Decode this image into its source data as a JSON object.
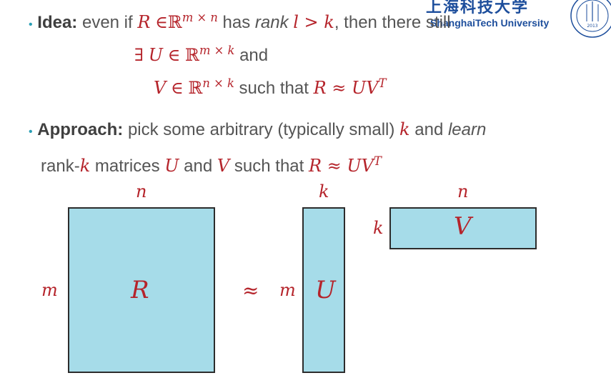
{
  "logo": {
    "cn": "上海科技大学",
    "en": "ShanghaiTech University",
    "seal_year": "2013",
    "seal_text": "SHANGHAITECH UNIV"
  },
  "idea": {
    "bullet": "•",
    "label": "Idea:",
    "text1": "even if",
    "R": "R",
    "in1": "∈",
    "reals1": "ℝ",
    "dims1": "m × n",
    "text2": "has",
    "rank": "rank",
    "rank_expr": "l > k",
    "text3": ", then there still",
    "line2_exists": "∃",
    "line2_U": "U",
    "line2_in": "∈",
    "line2_reals": "ℝ",
    "line2_dims": "m × k",
    "line2_and": "and",
    "line3_V": "V",
    "line3_in": "∈",
    "line3_reals": "ℝ",
    "line3_dims": "n × k",
    "line3_such": "such that",
    "line3_expr": "R ≈ UV",
    "line3_T": "T"
  },
  "approach": {
    "bullet": "•",
    "label": "Approach:",
    "text1": "pick some arbitrary (typically small)",
    "k": "k",
    "and": "and",
    "learn": "learn",
    "line2_rank": "rank-",
    "line2_k": "k",
    "line2_text": "matrices",
    "line2_U": "U",
    "line2_and": "and",
    "line2_V": "V",
    "line2_such": "such that",
    "line2_expr": "R ≈ UV",
    "line2_T": "T"
  },
  "diagram": {
    "R_label": "R",
    "R_cols": "n",
    "R_rows": "m",
    "approx": "≈",
    "U_label": "U",
    "U_cols": "k",
    "U_rows": "m",
    "V_label": "V",
    "V_cols": "n",
    "V_rows": "k",
    "box_fill": "#a6dce9",
    "math_color": "#b5242b"
  }
}
